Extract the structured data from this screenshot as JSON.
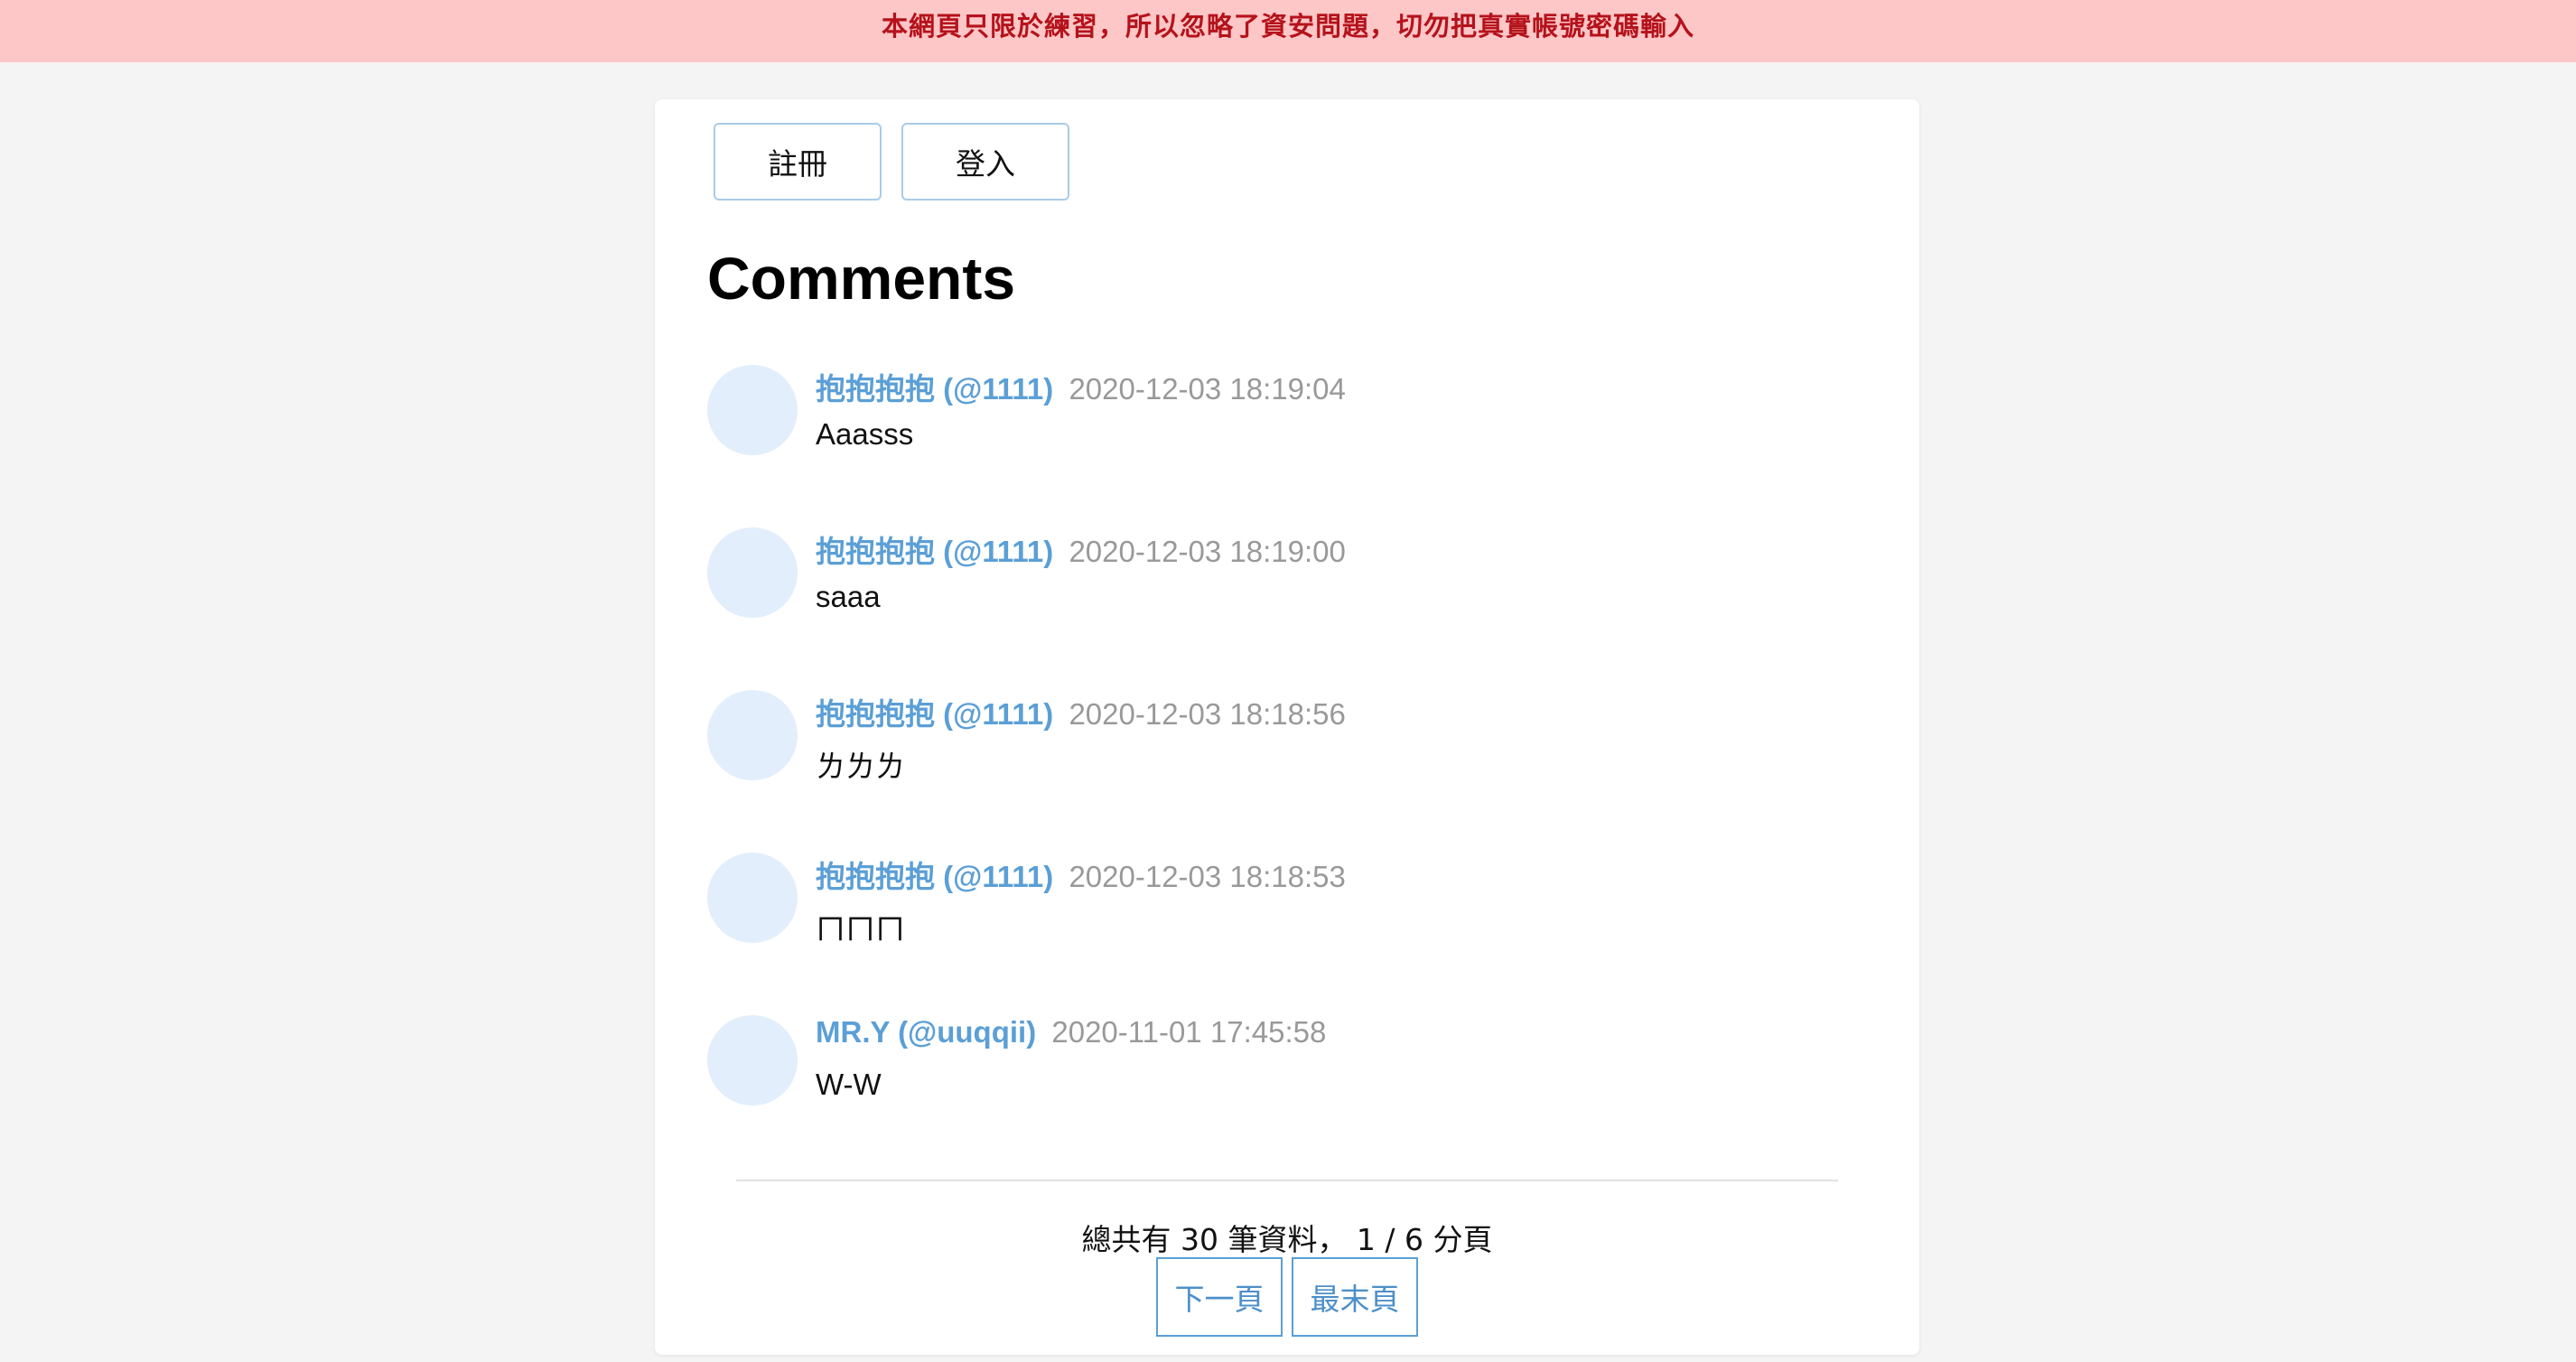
{
  "banner": {
    "text": "本網頁只限於練習，所以忽略了資安問題，切勿把真實帳號密碼輸入"
  },
  "auth": {
    "register_label": "註冊",
    "login_label": "登入"
  },
  "page_title": "Comments",
  "comments": [
    {
      "author": "抱抱抱抱 (@1111)",
      "time": "2020-12-03 18:19:04",
      "body": "Aaasss"
    },
    {
      "author": "抱抱抱抱 (@1111)",
      "time": "2020-12-03 18:19:00",
      "body": "saaa"
    },
    {
      "author": "抱抱抱抱 (@1111)",
      "time": "2020-12-03 18:18:56",
      "body": "ㄌㄌㄌ"
    },
    {
      "author": "抱抱抱抱 (@1111)",
      "time": "2020-12-03 18:18:53",
      "body": "ㄇㄇㄇ"
    },
    {
      "author": "MR.Y (@uuqqii)",
      "time": "2020-11-01 17:45:58",
      "body": "W-W"
    }
  ],
  "pagination": {
    "summary": "總共有 30 筆資料， 1 / 6 分頁",
    "next_label": "下一頁",
    "last_label": "最末頁"
  }
}
